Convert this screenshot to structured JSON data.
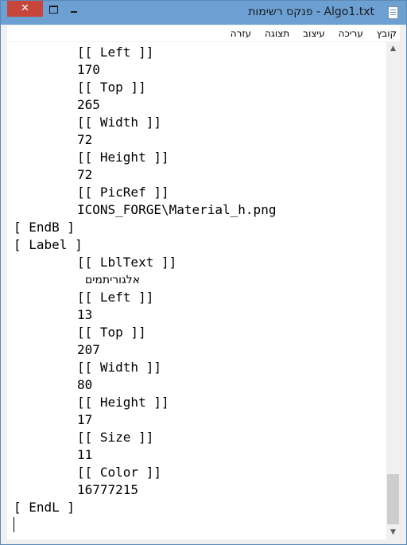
{
  "window": {
    "title": "Algo1.txt - פנקס רשימות",
    "close_label": "✕"
  },
  "menu": {
    "items": [
      "קובץ",
      "עריכה",
      "עיצוב",
      "תצוגה",
      "עזרה"
    ]
  },
  "document": {
    "lines": [
      "[[ Left ]]",
      "170",
      "[[ Top ]]",
      "265",
      "[[ Width ]]",
      "72",
      "[[ Height ]]",
      "72",
      "[[ PicRef ]]",
      "ICONS_FORGE\\Material_h.png",
      "[ EndB ]",
      "[ Label ]",
      "[[ LblText ]]",
      "אלגוריתמים",
      "[[ Left ]]",
      "13",
      "[[ Top ]]",
      "207",
      "[[ Width ]]",
      "80",
      "[[ Height ]]",
      "17",
      "[[ Size ]]",
      "11",
      "[[ Color ]]",
      "16777215",
      "[ EndL ]"
    ]
  },
  "icons": {
    "app": "notepad-icon",
    "close": "close-icon",
    "maximize": "maximize-icon",
    "minimize": "minimize-icon",
    "scroll_up": "scroll-up-arrow-icon",
    "scroll_down": "scroll-down-arrow-icon"
  },
  "colors": {
    "titlebar": "#6c9fd2",
    "close_button": "#c7463c"
  }
}
